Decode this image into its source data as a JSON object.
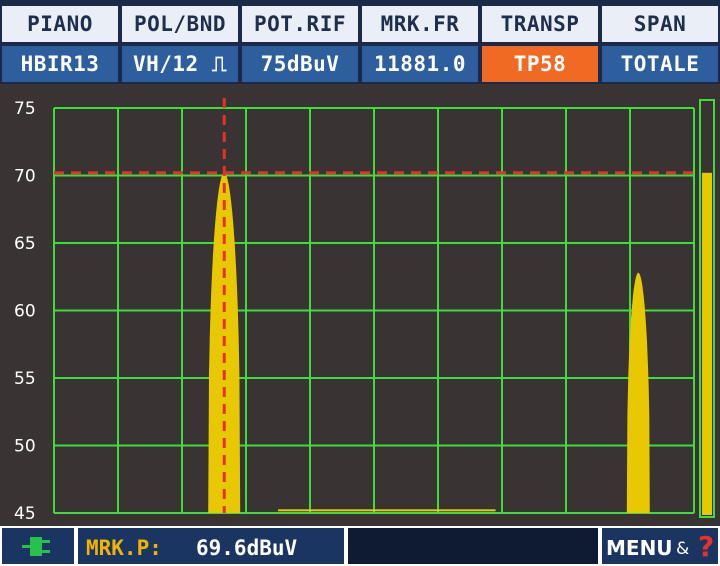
{
  "header": {
    "columns": [
      {
        "label": "PIANO",
        "value": "HBIR13"
      },
      {
        "label": "POL/BND",
        "value": "VH/12 ⎍"
      },
      {
        "label": "POT.RIF",
        "value": "75dBuV"
      },
      {
        "label": "MRK.FR",
        "value": "11881.0"
      },
      {
        "label": "TRANSP",
        "value": "TP58"
      },
      {
        "label": "SPAN",
        "value": "TOTALE"
      }
    ],
    "active_value_color": "#f06a23"
  },
  "chart_data": {
    "type": "area",
    "ylim": [
      45,
      75
    ],
    "yticks": [
      75,
      70,
      65,
      60,
      55,
      50,
      45
    ],
    "grid": true,
    "grid_color": "#3fdd3a",
    "fill_color": "#e8c800",
    "marker_level": 70.2,
    "marker_color": "#e8302a",
    "level_bar_value": 70.2,
    "x_divisions": 10,
    "peaks": [
      {
        "center": 2.66,
        "half_width": 0.25,
        "peak": 70.2
      },
      {
        "center": 9.13,
        "half_width": 0.18,
        "peak": 62.8
      }
    ],
    "floor_segments": [
      {
        "x0": 3.5,
        "x1": 6.9,
        "level": 45.2
      }
    ]
  },
  "statusbar": {
    "plug_icon": "plug-icon",
    "marker_label": "MRK.P:",
    "marker_value": "69.6dBuV",
    "menu_label": "MENU",
    "amp": "&",
    "help": "?"
  }
}
